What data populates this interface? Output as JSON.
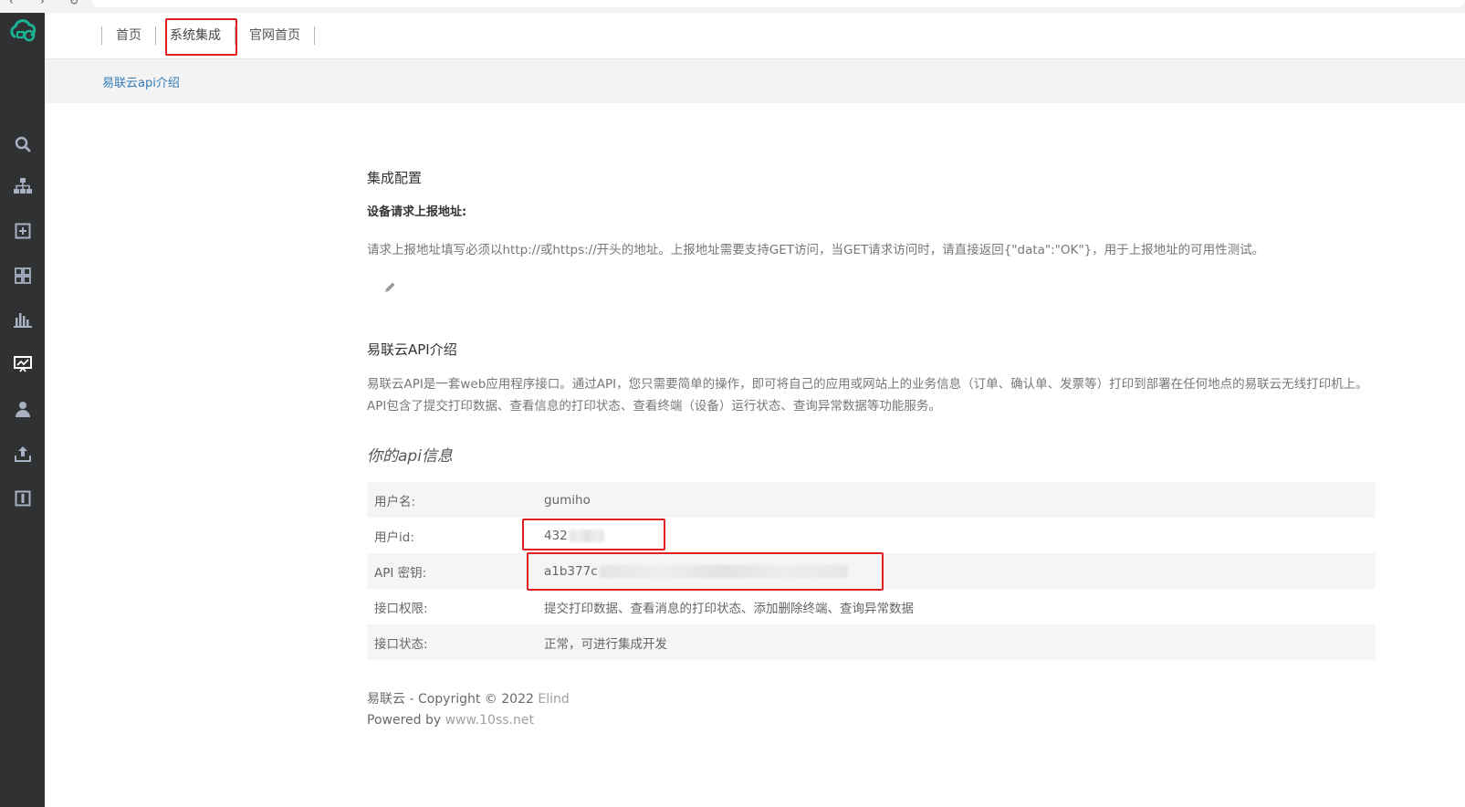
{
  "colors": {
    "sidebar_bg": "#2f3133",
    "logo_green": "#1ab394",
    "highlight_red": "#e02020",
    "link_blue": "#337ab7",
    "crumb_band": "#f3f3f4"
  },
  "sidebar": {
    "logo_icon": "cloud-printer-logo-icon",
    "icons": [
      "search-icon",
      "sitemap-icon",
      "plus-square-icon",
      "grid-icon",
      "bar-chart-icon",
      "monitor-icon",
      "user-icon",
      "upload-icon",
      "info-square-icon"
    ]
  },
  "topnav": {
    "items": [
      {
        "label": "首页"
      },
      {
        "label": "系统集成"
      },
      {
        "label": "官网首页"
      }
    ]
  },
  "breadcrumb": {
    "label": "易联云api介绍"
  },
  "config": {
    "heading": "集成配置",
    "url_label": "设备请求上报地址:",
    "url_desc": "请求上报地址填写必须以http://或https://开头的地址。上报地址需要支持GET访问，当GET请求访问时，请直接返回{\"data\":\"OK\"}，用于上报地址的可用性测试。",
    "edit_icon": "pencil-icon"
  },
  "intro": {
    "heading": "易联云API介绍",
    "text": "易联云API是一套web应用程序接口。通过API，您只需要简单的操作，即可将自己的应用或网站上的业务信息（订单、确认单、发票等）打印到部署在任何地点的易联云无线打印机上。API包含了提交打印数据、查看信息的打印状态、查看终端（设备）运行状态、查询异常数据等功能服务。"
  },
  "api_info": {
    "heading": "你的api信息",
    "rows": [
      {
        "key": "用户名:",
        "value": "gumiho"
      },
      {
        "key": "用户id:",
        "value": "432"
      },
      {
        "key": "API 密钥:",
        "value": "a1b377c"
      },
      {
        "key": "接口权限:",
        "value": "提交打印数据、查看消息的打印状态、添加删除终端、查询异常数据"
      },
      {
        "key": "接口状态:",
        "value": "正常，可进行集成开发"
      }
    ]
  },
  "footer": {
    "line1_prefix": "易联云 - Copyright © 2022",
    "line1_link": "Elind",
    "line2_prefix": "Powered by",
    "line2_link": "www.10ss.net"
  }
}
